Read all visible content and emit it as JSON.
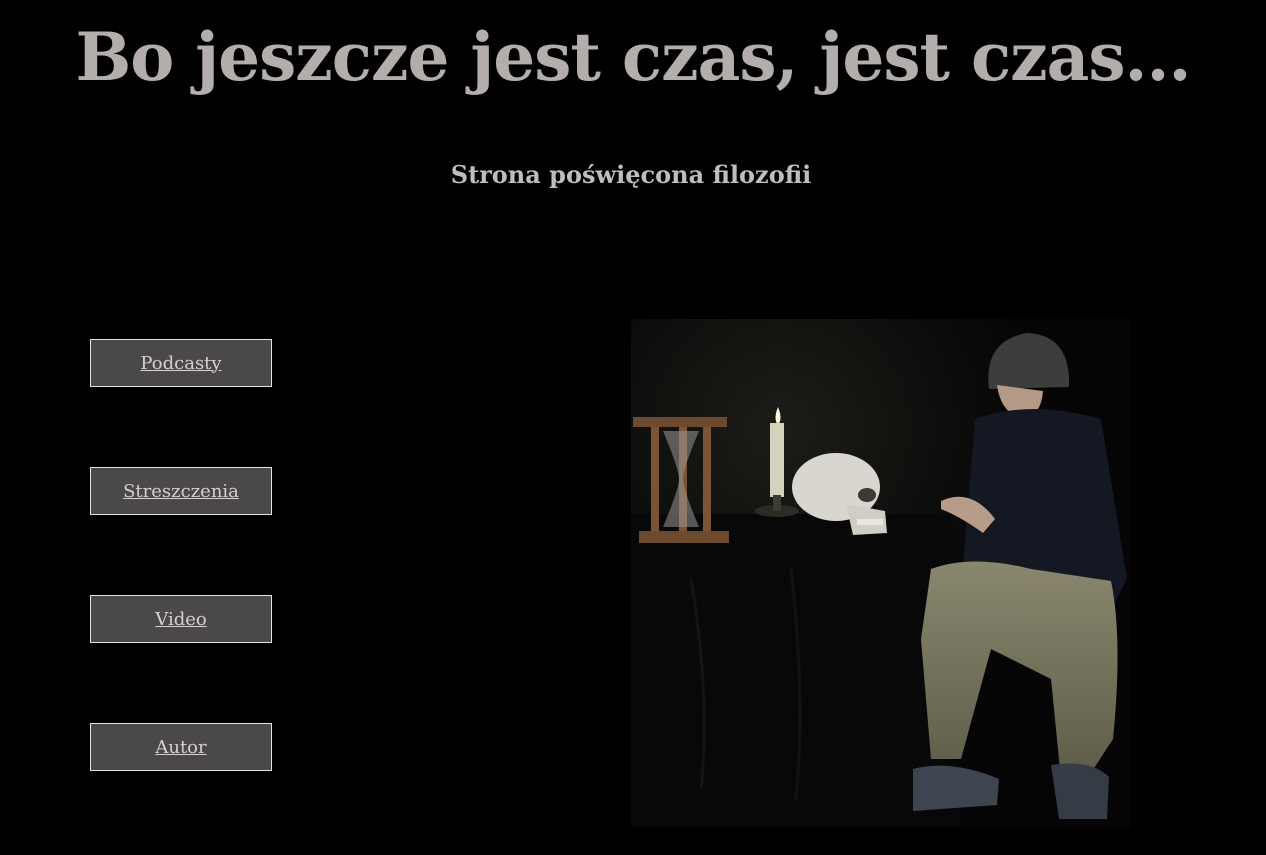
{
  "header": {
    "title": "Bo jeszcze jest czas, jest czas...",
    "subtitle": "Strona poświęcona filozofii"
  },
  "nav": {
    "items": [
      {
        "label": "Podcasty"
      },
      {
        "label": "Streszczenia"
      },
      {
        "label": "Video"
      },
      {
        "label": "Autor"
      }
    ]
  },
  "colors": {
    "background": "#000000",
    "title": "#b3adab",
    "button_bg": "#4a4849",
    "button_border": "#e2e2e2"
  }
}
